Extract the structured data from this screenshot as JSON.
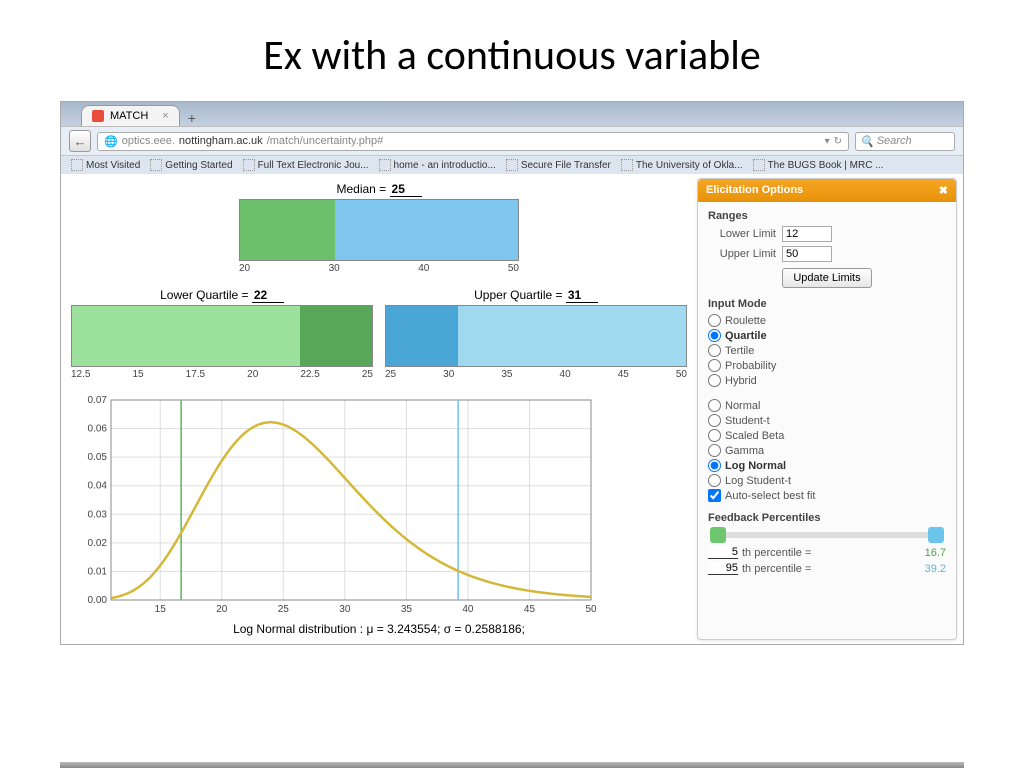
{
  "slide": {
    "title": "Ex with a continuous variable"
  },
  "browser": {
    "tab_title": "MATCH",
    "url_prefix": "optics.eee.",
    "url_host": "nottingham.ac.uk",
    "url_path": "/match/uncertainty.php#",
    "search_placeholder": "Search",
    "bookmarks": [
      "Most Visited",
      "Getting Started",
      "Full Text Electronic Jou...",
      "home - an introductio...",
      "Secure File Transfer",
      "The University of Okla...",
      "The BUGS Book | MRC ..."
    ]
  },
  "median": {
    "label": "Median =",
    "value": "25"
  },
  "lower_q": {
    "label": "Lower Quartile =",
    "value": "22"
  },
  "upper_q": {
    "label": "Upper Quartile =",
    "value": "31"
  },
  "dist_caption": "Log Normal distribution : μ = 3.243554; σ = 0.2588186;",
  "panel": {
    "title": "Elicitation Options",
    "ranges_title": "Ranges",
    "lower_label": "Lower Limit",
    "lower_val": "12",
    "upper_label": "Upper Limit",
    "upper_val": "50",
    "update_btn": "Update Limits",
    "input_mode_title": "Input Mode",
    "input_modes": [
      "Roulette",
      "Quartile",
      "Tertile",
      "Probability",
      "Hybrid"
    ],
    "input_mode_selected": "Quartile",
    "dist_types": [
      "Normal",
      "Student-t",
      "Scaled Beta",
      "Gamma",
      "Log Normal",
      "Log Student-t"
    ],
    "dist_selected": "Log Normal",
    "auto_fit_label": "Auto-select best fit",
    "feedback_title": "Feedback Percentiles",
    "pct1_n": "5",
    "pct1_val": "16.7",
    "pct2_n": "95",
    "pct2_val": "39.2",
    "pct_label": "th percentile ="
  },
  "chart_data": {
    "median_bar": {
      "type": "bar",
      "xlim": [
        12,
        50
      ],
      "split": 25,
      "ticks": [
        20,
        30,
        40,
        50
      ],
      "left_color": "#6cc06c",
      "right_color": "#7ec6ed"
    },
    "lower_bar": {
      "type": "bar",
      "xlim": [
        12.5,
        25
      ],
      "split": 22,
      "ticks": [
        12.5,
        15,
        17.5,
        20,
        22.5,
        25
      ],
      "left_color": "#9ce29c",
      "right_color": "#59a859"
    },
    "upper_bar": {
      "type": "bar",
      "xlim": [
        25,
        50
      ],
      "split": 31,
      "ticks": [
        25,
        30,
        35,
        40,
        45,
        50
      ],
      "left_color": "#4aa6d4",
      "right_color": "#9ed9f0"
    },
    "density": {
      "type": "line",
      "xlim": [
        11,
        50
      ],
      "ylim": [
        0,
        0.07
      ],
      "xticks": [
        15,
        20,
        25,
        30,
        35,
        40,
        45,
        50
      ],
      "yticks": [
        0.0,
        0.01,
        0.02,
        0.03,
        0.04,
        0.05,
        0.06,
        0.07
      ],
      "vlines": [
        {
          "x": 16.7,
          "color": "#5bb85b"
        },
        {
          "x": 39.2,
          "color": "#6bc4ea"
        }
      ],
      "series": [
        {
          "name": "Log Normal pdf",
          "color": "#d4b838",
          "mu": 3.243554,
          "sigma": 0.2588186
        }
      ]
    }
  }
}
